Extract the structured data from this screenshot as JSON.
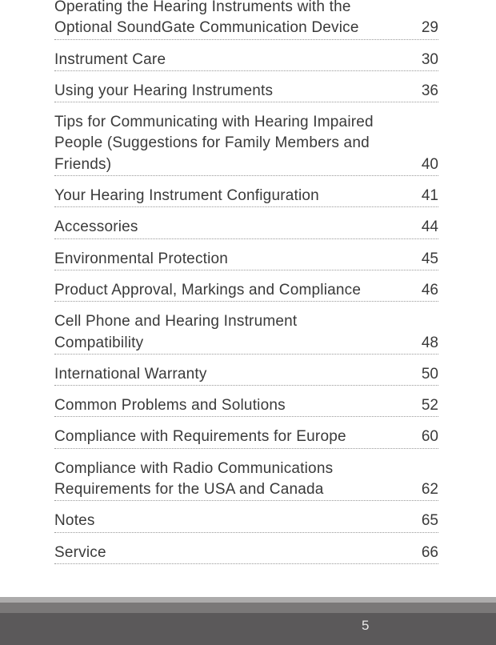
{
  "toc": [
    {
      "title": "Operating the Hearing Instruments with the Optional SoundGate Communication Device",
      "page": "29"
    },
    {
      "title": "Instrument Care",
      "page": "30"
    },
    {
      "title": "Using your Hearing Instruments",
      "page": "36"
    },
    {
      "title": "Tips for Communicating with Hearing Impaired People (Suggestions for Family Members and Friends)",
      "page": "40"
    },
    {
      "title": "Your Hearing Instrument Configuration",
      "page": "41"
    },
    {
      "title": "Accessories",
      "page": "44"
    },
    {
      "title": "Environmental Protection",
      "page": "45"
    },
    {
      "title": "Product Approval, Markings and Compliance",
      "page": "46"
    },
    {
      "title": "Cell Phone and Hearing Instrument Compatibility",
      "page": "48"
    },
    {
      "title": "International Warranty",
      "page": "50"
    },
    {
      "title": "Common Problems and Solutions",
      "page": "52"
    },
    {
      "title": "Compliance with Requirements for Europe",
      "page": "60"
    },
    {
      "title": "Compliance with Radio Communications Requirements for the USA and Canada",
      "page": "62"
    },
    {
      "title": "Notes",
      "page": "65"
    },
    {
      "title": "Service",
      "page": "66"
    }
  ],
  "footer": {
    "page_number": "5"
  }
}
